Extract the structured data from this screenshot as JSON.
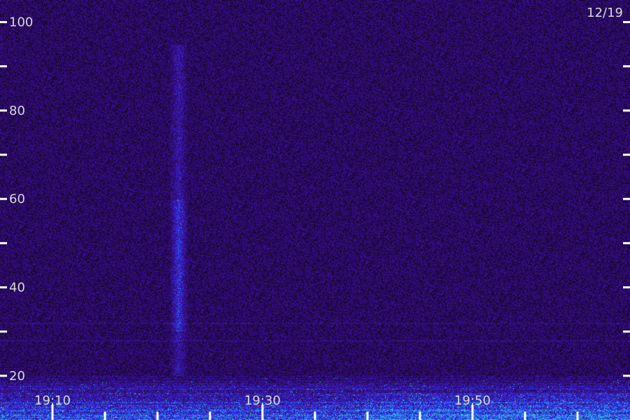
{
  "chart_data": {
    "type": "heatmap",
    "title": "",
    "date_label": "12/19",
    "y_ticks": [
      {
        "value": 20,
        "label": "20"
      },
      {
        "value": 30,
        "label": ""
      },
      {
        "value": 40,
        "label": "40"
      },
      {
        "value": 50,
        "label": ""
      },
      {
        "value": 60,
        "label": "60"
      },
      {
        "value": 70,
        "label": ""
      },
      {
        "value": 80,
        "label": "80"
      },
      {
        "value": 90,
        "label": ""
      },
      {
        "value": 100,
        "label": "100"
      }
    ],
    "ylim": [
      10,
      105
    ],
    "xlim": [
      "19:05",
      "20:05"
    ],
    "x_ticks_labeled": [
      {
        "time": "19:10",
        "label": "19:10"
      },
      {
        "time": "19:30",
        "label": "19:30"
      },
      {
        "time": "19:50",
        "label": "19:50"
      }
    ],
    "x_ticks_minor": [
      "19:15",
      "19:20",
      "19:25",
      "19:35",
      "19:40",
      "19:45",
      "19:55",
      "20:00"
    ],
    "features": [
      {
        "kind": "vertical-burst",
        "time": "19:22",
        "y_range": [
          20,
          95
        ],
        "intensity": "high between 30 and 60"
      },
      {
        "kind": "low-band-noise",
        "y_range": [
          10,
          20
        ]
      },
      {
        "kind": "faint-horizontal-line",
        "y": 32
      },
      {
        "kind": "faint-horizontal-line",
        "y": 28
      }
    ],
    "colormap": [
      "#000000",
      "#2a0a55",
      "#3b0fa0",
      "#3040ff",
      "#20c0ff",
      "#40ff80"
    ],
    "grid": false
  }
}
